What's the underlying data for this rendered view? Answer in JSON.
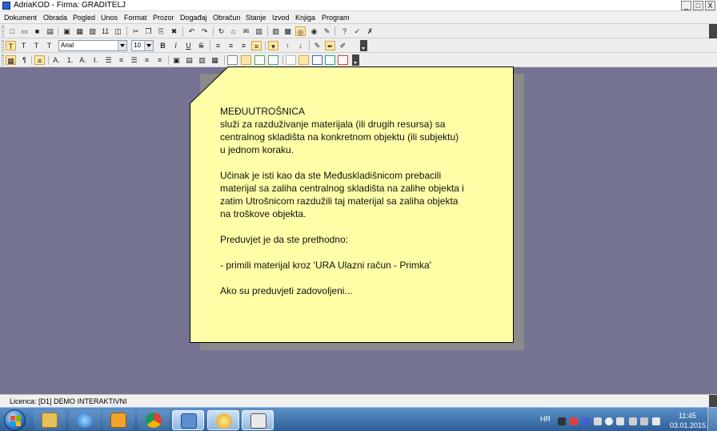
{
  "window": {
    "title": "AdriaKOD - Firma: GRADITELJ",
    "minimize_label": "_",
    "restore_label": "□",
    "close_label": "X"
  },
  "menu": [
    "Dokument",
    "Obrada",
    "Pogled",
    "Unos",
    "Format",
    "Prozor",
    "Događaj",
    "Obračun",
    "Stanje",
    "Izvod",
    "Knjiga",
    "Program"
  ],
  "toolbar1": {
    "glyphs": [
      "□",
      "▭",
      "■",
      "▤",
      "▣",
      "▦",
      "▧",
      "11",
      "◫",
      "✂",
      "❐",
      "⎘",
      "✖",
      "↶",
      "↷",
      "↻",
      "⌂",
      "✉",
      "▥",
      "▨",
      "▩",
      "◎",
      "◉",
      "✎",
      "?",
      "✓",
      "✗"
    ]
  },
  "toolbar2": {
    "text_styles": [
      "T",
      "T",
      "T",
      "T"
    ],
    "font_name": "Arial",
    "font_size": "10",
    "format_buttons": [
      "B",
      "I",
      "U",
      "S"
    ],
    "glyphs": [
      "≡",
      "≡",
      "≡",
      "≡",
      "▾",
      "↑",
      "↓",
      "✎",
      "✒",
      "✐"
    ]
  },
  "toolbar3": {
    "list_buttons": [
      "A.",
      "1.",
      "A.",
      "I."
    ],
    "glyphs": [
      "☰",
      "≡",
      "☰",
      "≡",
      "▣",
      "▤",
      "▥",
      "▦"
    ]
  },
  "colors": {
    "desktop": "#757392",
    "note_fill": "#ffffa8",
    "note_border": "#000000",
    "note_shadow": "#8a8a8a",
    "taskbar": "#2f5f98"
  },
  "note": {
    "lines": [
      "MEĐUUTROŠNICA",
      "služi za razduživanje materijala (ili drugih resursa) sa",
      "centralnog skladišta na konkretnom objektu (ili subjektu)",
      "u jednom koraku.",
      "",
      "Učinak je isti kao da ste Međuskladišnicom prebacili",
      "materijal sa zaliha centralnog skladišta na zalihe objekta i",
      "zatim Utrošnicom razdužili taj materijal sa zaliha objekta",
      "na troškove objekta.",
      "",
      "Preduvjet je da ste prethodno:",
      "",
      "- primili materijal kroz 'URA Ulazni račun - Primka'",
      "",
      "Ako su preduvjeti zadovoljeni..."
    ]
  },
  "status": {
    "license": "Licenca:  [D1] DEMO INTERAKTIVNI"
  },
  "taskbar": {
    "language": "HR",
    "time": "11:45",
    "date": "03.01.2015."
  }
}
